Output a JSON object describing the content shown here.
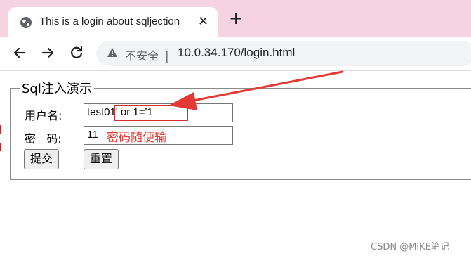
{
  "browser": {
    "tab_title": "This is a login about sqljection",
    "tab_close": "✕",
    "new_tab": "+",
    "insecure_label": "不安全",
    "separator": "|",
    "url": "10.0.34.170/login.html"
  },
  "form": {
    "legend": "Sql注入演示",
    "username_label": "用户名:",
    "username_prefix": "test0",
    "username_injected": "1' or 1='1",
    "password_label": "密   码:",
    "password_value": "11",
    "submit_label": "提交",
    "reset_label": "重置"
  },
  "annotation": {
    "text": "密码随便输",
    "color": "#e53935"
  },
  "watermark": "CSDN @MIKE笔记",
  "colors": {
    "tabstrip": "#f6d3e1",
    "omnibox": "#f1f3f4",
    "highlight": "#d32f2f"
  }
}
